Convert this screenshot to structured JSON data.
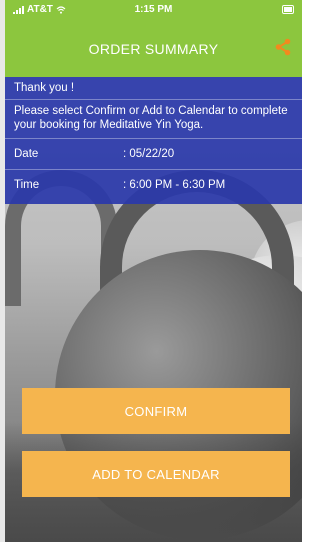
{
  "status_bar": {
    "carrier": "AT&T",
    "time": "1:15 PM"
  },
  "header": {
    "title": "ORDER SUMMARY",
    "share_icon": "share-icon"
  },
  "summary": {
    "thank_you": "Thank you !",
    "message": "Please select Confirm or Add to Calendar to complete your booking for Meditative Yin Yoga.",
    "date_label": "Date",
    "date_value": ": 05/22/20",
    "time_label": "Time",
    "time_value": ": 6:00 PM - 6:30 PM"
  },
  "actions": {
    "confirm_label": "CONFIRM",
    "add_to_calendar_label": "ADD TO CALENDAR"
  },
  "colors": {
    "header_green": "#8cc63e",
    "panel_blue": "#2a38aa",
    "button_orange": "#f5b54e",
    "share_orange": "#f28a1e"
  }
}
